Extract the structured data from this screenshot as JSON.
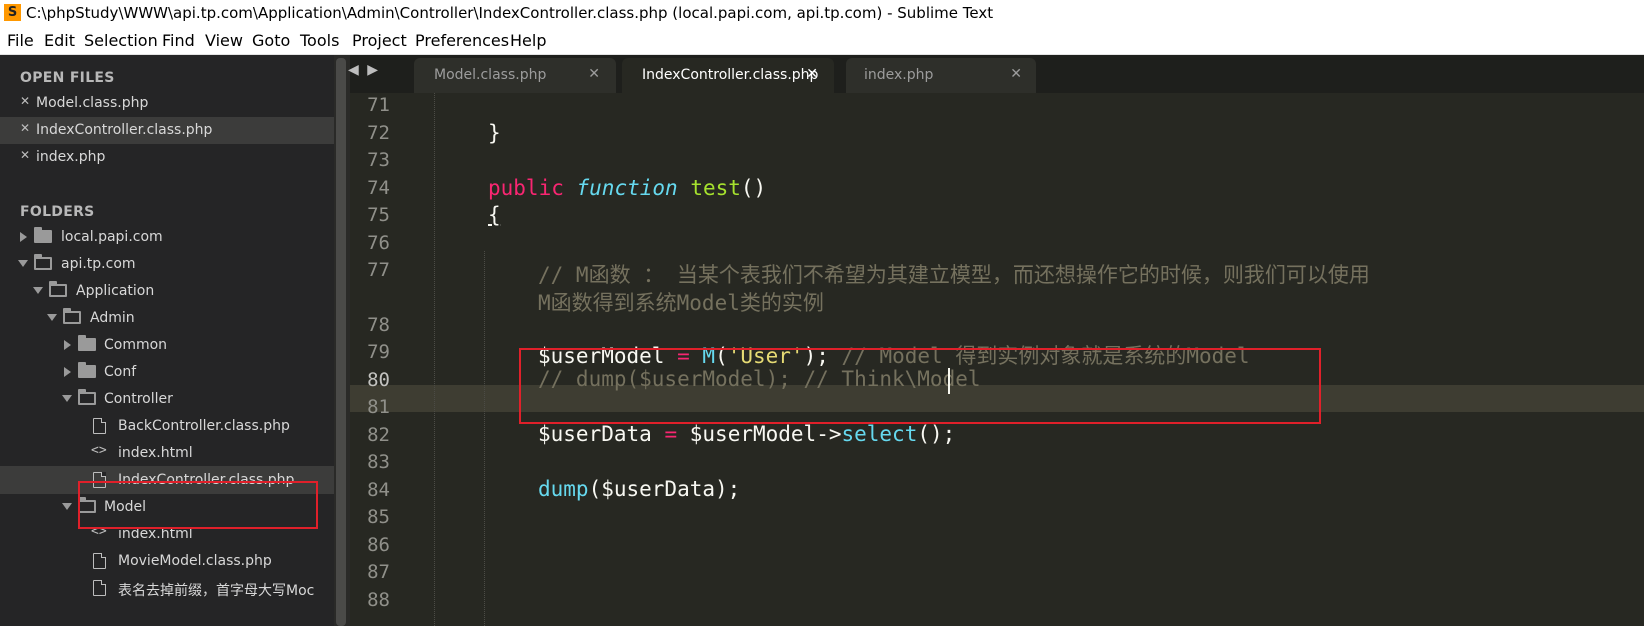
{
  "window": {
    "icon": "sublime-text-icon",
    "title": "C:\\phpStudy\\WWW\\api.tp.com\\Application\\Admin\\Controller\\IndexController.class.php (local.papi.com, api.tp.com) - Sublime Text"
  },
  "menu": [
    "File",
    "Edit",
    "Selection",
    "Find",
    "View",
    "Goto",
    "Tools",
    "Project",
    "Preferences",
    "Help"
  ],
  "sidebar": {
    "open_files_title": "OPEN FILES",
    "open_files": [
      "Model.class.php",
      "IndexController.class.php",
      "index.php"
    ],
    "folders_title": "FOLDERS",
    "tree": [
      {
        "label": "local.papi.com",
        "type": "folder",
        "expanded": false
      },
      {
        "label": "api.tp.com",
        "type": "folder",
        "expanded": true
      },
      {
        "label": "Application",
        "type": "folder",
        "expanded": true
      },
      {
        "label": "Admin",
        "type": "folder",
        "expanded": true
      },
      {
        "label": "Common",
        "type": "folder",
        "expanded": false
      },
      {
        "label": "Conf",
        "type": "folder",
        "expanded": false
      },
      {
        "label": "Controller",
        "type": "folder",
        "expanded": true
      },
      {
        "label": "BackController.class.php",
        "type": "file"
      },
      {
        "label": "index.html",
        "type": "html"
      },
      {
        "label": "IndexController.class.php",
        "type": "file",
        "active": true
      },
      {
        "label": "Model",
        "type": "folder",
        "expanded": true
      },
      {
        "label": "index.html",
        "type": "html"
      },
      {
        "label": "MovieModel.class.php",
        "type": "file"
      },
      {
        "label": "表名去掉前缀，首字母大写Moc",
        "type": "file"
      }
    ]
  },
  "tabs": [
    {
      "label": "Model.class.php",
      "active": false
    },
    {
      "label": "IndexController.class.php",
      "active": true
    },
    {
      "label": "index.php",
      "active": false
    }
  ],
  "editor": {
    "line_numbers": [
      "71",
      "72",
      "73",
      "74",
      "75",
      "76",
      "77",
      "78",
      "79",
      "80",
      "81",
      "82",
      "83",
      "84",
      "85",
      "86",
      "87",
      "88"
    ],
    "current_line": "80",
    "code": {
      "l72": "}",
      "l74_kw": "public",
      "l74_st": "function",
      "l74_fn": "test",
      "l74_paren": "()",
      "l75": "{",
      "l77a": "// M函数 ： 当某个表我们不希望为其建立模型，而还想操作它的时候，则我们可以使用",
      "l77b": "M函数得到系统Model类的实例",
      "l79_var": "$userModel",
      "l79_eq": "=",
      "l79_fn": "M",
      "l79_open": "(",
      "l79_str": "'User'",
      "l79_close": ");",
      "l79_cm": "// Model 得到实例对象就是系统的Model",
      "l80_cm": "// dump($userModel); // Think\\Model",
      "l82_var": "$userData",
      "l82_eq": "=",
      "l82_obj": "$userModel->",
      "l82_fn": "select",
      "l82_end": "();",
      "l84_fn": "dump",
      "l84_rest": "($userData);"
    }
  },
  "colors": {
    "keyword": "#f92672",
    "storage": "#66d9ef",
    "function": "#a6e22e",
    "string": "#e6db74",
    "comment": "#75715e",
    "annotation": "#e0202a"
  }
}
